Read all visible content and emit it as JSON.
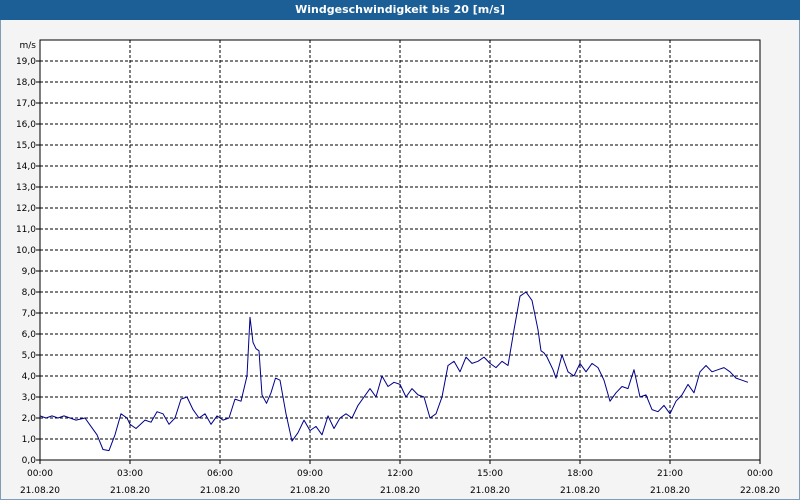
{
  "window": {
    "title": "Windgeschwindigkeit bis 20 [m/s]"
  },
  "colors": {
    "titlebar": "#1c5f96",
    "series": "#00008b",
    "grid": "#000000",
    "background": "#ffffff"
  },
  "chart_data": {
    "type": "line",
    "title": "Windgeschwindigkeit bis 20 [m/s]",
    "unit_label": "m/s",
    "ylim": [
      0,
      20
    ],
    "yticks": [
      "0,0",
      "1,0",
      "2,0",
      "3,0",
      "4,0",
      "5,0",
      "6,0",
      "7,0",
      "8,0",
      "9,0",
      "10,0",
      "11,0",
      "12,0",
      "13,0",
      "14,0",
      "15,0",
      "16,0",
      "17,0",
      "18,0",
      "19,0"
    ],
    "xlim_hours": [
      0,
      24
    ],
    "xticks": [
      {
        "time": "00:00",
        "date": "21.08.20"
      },
      {
        "time": "03:00",
        "date": "21.08.20"
      },
      {
        "time": "06:00",
        "date": "21.08.20"
      },
      {
        "time": "09:00",
        "date": "21.08.20"
      },
      {
        "time": "12:00",
        "date": "21.08.20"
      },
      {
        "time": "15:00",
        "date": "21.08.20"
      },
      {
        "time": "18:00",
        "date": "21.08.20"
      },
      {
        "time": "21:00",
        "date": "21.08.20"
      },
      {
        "time": "00:00",
        "date": "22.08.20"
      }
    ],
    "grid": true,
    "series": [
      {
        "x_hours": [
          0.0,
          0.2,
          0.4,
          0.6,
          0.8,
          1.0,
          1.2,
          1.5,
          1.7,
          1.9,
          2.1,
          2.3,
          2.5,
          2.7,
          2.9,
          3.0,
          3.2,
          3.5,
          3.7,
          3.9,
          4.1,
          4.3,
          4.5,
          4.7,
          4.9,
          5.1,
          5.3,
          5.5,
          5.7,
          5.9,
          6.1,
          6.3,
          6.5,
          6.7,
          6.9,
          7.0,
          7.1,
          7.2,
          7.3,
          7.4,
          7.55,
          7.7,
          7.85,
          8.0,
          8.2,
          8.4,
          8.6,
          8.8,
          9.0,
          9.2,
          9.4,
          9.6,
          9.8,
          10.0,
          10.2,
          10.4,
          10.6,
          10.8,
          11.0,
          11.2,
          11.4,
          11.6,
          11.8,
          12.0,
          12.2,
          12.4,
          12.6,
          12.8,
          13.0,
          13.2,
          13.4,
          13.6,
          13.8,
          14.0,
          14.2,
          14.4,
          14.6,
          14.8,
          15.0,
          15.2,
          15.4,
          15.6,
          15.8,
          16.0,
          16.2,
          16.4,
          16.6,
          16.7,
          16.8,
          16.9,
          17.0,
          17.1,
          17.2,
          17.4,
          17.6,
          17.8,
          18.0,
          18.2,
          18.4,
          18.6,
          18.8,
          19.0,
          19.2,
          19.4,
          19.6,
          19.8,
          20.0,
          20.2,
          20.4,
          20.6,
          20.8,
          21.0,
          21.2,
          21.4,
          21.6,
          21.8,
          22.0,
          22.2,
          22.4,
          22.6,
          22.8,
          23.0,
          23.2,
          23.4,
          23.6,
          23.8,
          23.9
        ],
        "values": [
          2.1,
          2.0,
          2.1,
          2.0,
          2.1,
          2.0,
          1.9,
          2.0,
          1.6,
          1.2,
          0.5,
          0.45,
          1.2,
          2.2,
          2.0,
          1.7,
          1.5,
          1.9,
          1.8,
          2.3,
          2.2,
          1.7,
          2.0,
          2.9,
          3.0,
          2.4,
          2.0,
          2.2,
          1.7,
          2.1,
          1.9,
          2.0,
          2.9,
          2.8,
          4.0,
          6.8,
          5.6,
          5.3,
          5.2,
          3.1,
          2.7,
          3.2,
          3.9,
          3.8,
          2.2,
          0.9,
          1.3,
          1.9,
          1.4,
          1.6,
          1.2,
          2.1,
          1.5,
          2.0,
          2.2,
          2.0,
          2.6,
          3.0,
          3.4,
          3.0,
          4.0,
          3.5,
          3.7,
          3.6,
          3.0,
          3.4,
          3.1,
          3.0,
          2.0,
          2.2,
          3.0,
          4.5,
          4.7,
          4.2,
          4.9,
          4.6,
          4.7,
          4.9,
          4.6,
          4.4,
          4.7,
          4.5,
          6.2,
          7.8,
          8.0,
          7.6,
          6.2,
          5.2,
          5.1,
          4.9,
          4.6,
          4.3,
          3.9,
          5.0,
          4.2,
          4.0,
          4.6,
          4.2,
          4.6,
          4.4,
          3.8,
          2.8,
          3.2,
          3.5,
          3.4,
          4.3,
          3.0,
          3.1,
          2.4,
          2.3,
          2.6,
          2.2,
          2.8,
          3.1,
          3.6,
          3.2,
          4.2,
          4.5,
          4.2,
          4.3,
          4.4,
          4.2,
          3.9,
          3.8,
          3.7
        ]
      }
    ]
  }
}
